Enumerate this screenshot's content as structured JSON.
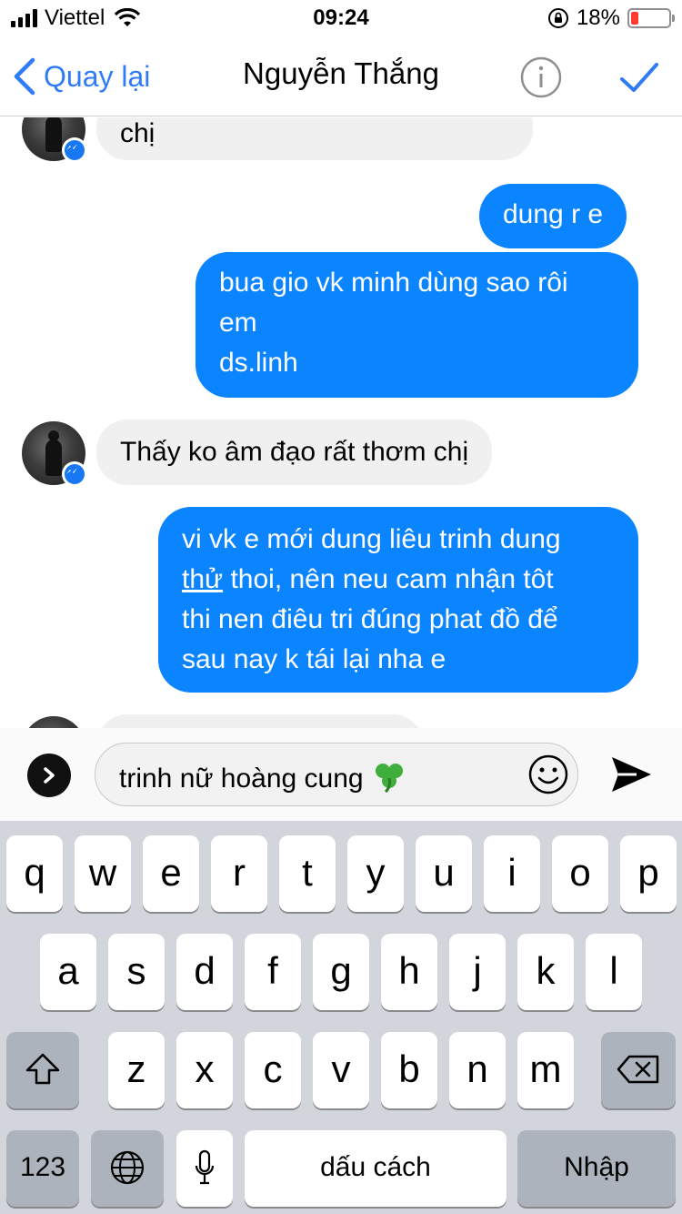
{
  "status_bar": {
    "carrier": "Viettel",
    "time": "09:24",
    "battery": "18%",
    "battery_level": 0.18,
    "icons": [
      "signal-icon",
      "wifi-icon",
      "rotation-lock-icon",
      "battery-icon"
    ]
  },
  "nav": {
    "back_label": "Quay lại",
    "title": "Nguyễn Thắng",
    "icons": [
      "chevron-left-icon",
      "info-icon",
      "checkmark-icon"
    ]
  },
  "messages": [
    {
      "side": "incoming",
      "text": "chị"
    },
    {
      "side": "outgoing",
      "text": "dung r e"
    },
    {
      "side": "outgoing",
      "lines": [
        "bua gio vk minh dùng sao rôi",
        "em",
        "ds.linh"
      ]
    },
    {
      "side": "incoming",
      "text": "Thấy ko âm đạo rất thơm chị"
    },
    {
      "side": "outgoing",
      "lines_prefix": "vi vk e mới dung liêu trinh dung",
      "underlined": "thử",
      "line2_rest": " thoi, nên neu cam nhận tôt",
      "lines_after": [
        "thi nen điêu tri đúng phat đồ để",
        "sau nay k tái lại nha e"
      ]
    }
  ],
  "composer": {
    "text": "trinh nữ hoàng cung",
    "emoji": "shamrock",
    "icons": [
      "expand-icon",
      "emoji-icon",
      "send-icon"
    ]
  },
  "keyboard": {
    "row1": [
      "q",
      "w",
      "e",
      "r",
      "t",
      "y",
      "u",
      "i",
      "o",
      "p"
    ],
    "row2": [
      "a",
      "s",
      "d",
      "f",
      "g",
      "h",
      "j",
      "k",
      "l"
    ],
    "row3": [
      "z",
      "x",
      "c",
      "v",
      "b",
      "n",
      "m"
    ],
    "numbers_label": "123",
    "space_label": "dấu cách",
    "return_label": "Nhập",
    "icons": [
      "shift-icon",
      "backspace-icon",
      "globe-icon",
      "microphone-icon"
    ]
  },
  "colors": {
    "outgoing_bubble": "#0a84ff",
    "incoming_bubble": "#f0f0f0",
    "accent": "#2f7cf6",
    "keyboard_bg": "#d2d5db"
  }
}
